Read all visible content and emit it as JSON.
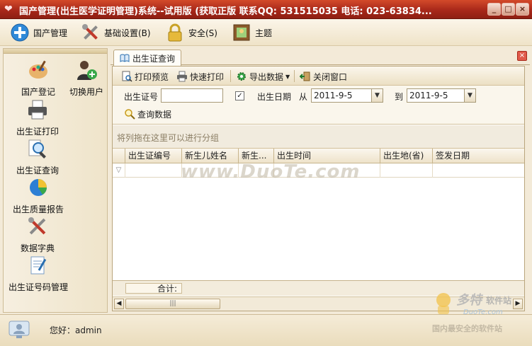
{
  "window": {
    "title": "国产管理(出生医学证明管理)系统--试用版 (获取正版  联系QQ: 531515035 电话: 023-63834...",
    "buttons": {
      "minimize": "_",
      "maximize": "□",
      "close": "×"
    }
  },
  "toolbar": {
    "items": [
      {
        "label": "国产管理",
        "icon": "plus-circle-icon"
      },
      {
        "label": "基础设置(B)",
        "icon": "tools-icon"
      },
      {
        "label": "安全(S)",
        "icon": "lock-icon"
      },
      {
        "label": "主题",
        "icon": "picture-frame-icon"
      }
    ]
  },
  "sidebar": {
    "items": [
      {
        "label": "国产登记",
        "icon": "palette-icon"
      },
      {
        "label": "切换用户",
        "icon": "user-switch-icon"
      },
      {
        "label": "出生证打印",
        "icon": "printer-icon"
      },
      {
        "label": "出生证查询",
        "icon": "magnifier-icon"
      },
      {
        "label": "出生质量报告",
        "icon": "pie-chart-icon"
      },
      {
        "label": "数据字典",
        "icon": "tools-icon"
      },
      {
        "label": "出生证号码管理",
        "icon": "document-edit-icon"
      }
    ]
  },
  "tab": {
    "label": "出生证查询",
    "close": "×"
  },
  "subtoolbar": {
    "print_preview": "打印预览",
    "quick_print": "快速打印",
    "export_data": "导出数据",
    "close_window": "关闭窗口"
  },
  "filters": {
    "cert_no_label": "出生证号",
    "cert_no_value": "",
    "birth_date_label": "出生日期",
    "from_label": "从",
    "from_value": "2011-9-5",
    "to_label": "到",
    "to_value": "2011-9-5",
    "checkbox_checked": "✓",
    "query_button": "查询数据"
  },
  "grid": {
    "group_hint": "将列拖在这里可以进行分组",
    "columns": [
      "出生证编号",
      "新生儿姓名",
      "新生...",
      "出生时间",
      "出生地(省)",
      "签发日期"
    ],
    "filter_icon": "▽",
    "footer_label": "合计:"
  },
  "status": {
    "greeting": "您好：admin"
  },
  "watermark": {
    "text": "www.DuoTe.com",
    "logo_top": "多特",
    "logo_right": "软件站",
    "logo_url": "DuoTe.com",
    "logo_bottom": "国内最安全的软件站"
  },
  "colors": {
    "title_red": "#a8281a",
    "beige": "#f3ead8",
    "border": "#b9a57d"
  }
}
